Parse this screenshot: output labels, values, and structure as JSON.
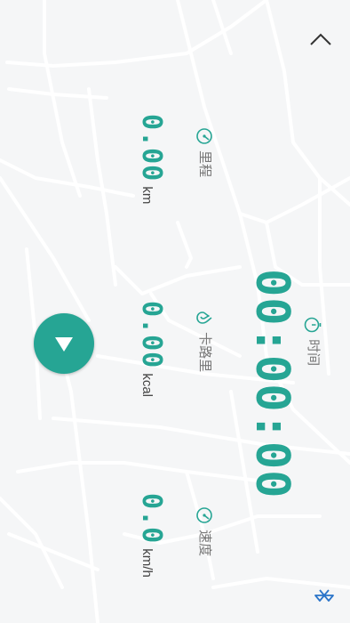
{
  "stats": {
    "distance": {
      "value": "0.00",
      "unit": "km",
      "label": "里程"
    },
    "calories": {
      "value": "0.00",
      "unit": "kcal",
      "label": "卡路里"
    },
    "speed": {
      "value": "0.0",
      "unit": "km/h",
      "label": "速度"
    },
    "time": {
      "value": "00:00:00",
      "label": "时间"
    }
  },
  "icons": {
    "collapse": "chevron-up-icon",
    "play": "triangle-down-icon",
    "bluetooth": "bluetooth-icon",
    "distance": "odometer-icon",
    "calories": "flame-icon",
    "speed": "speedometer-icon",
    "time": "stopwatch-icon"
  },
  "colors": {
    "accent": "#26a594",
    "background": "#f5f6f7",
    "bluetooth": "#2a74c9"
  }
}
